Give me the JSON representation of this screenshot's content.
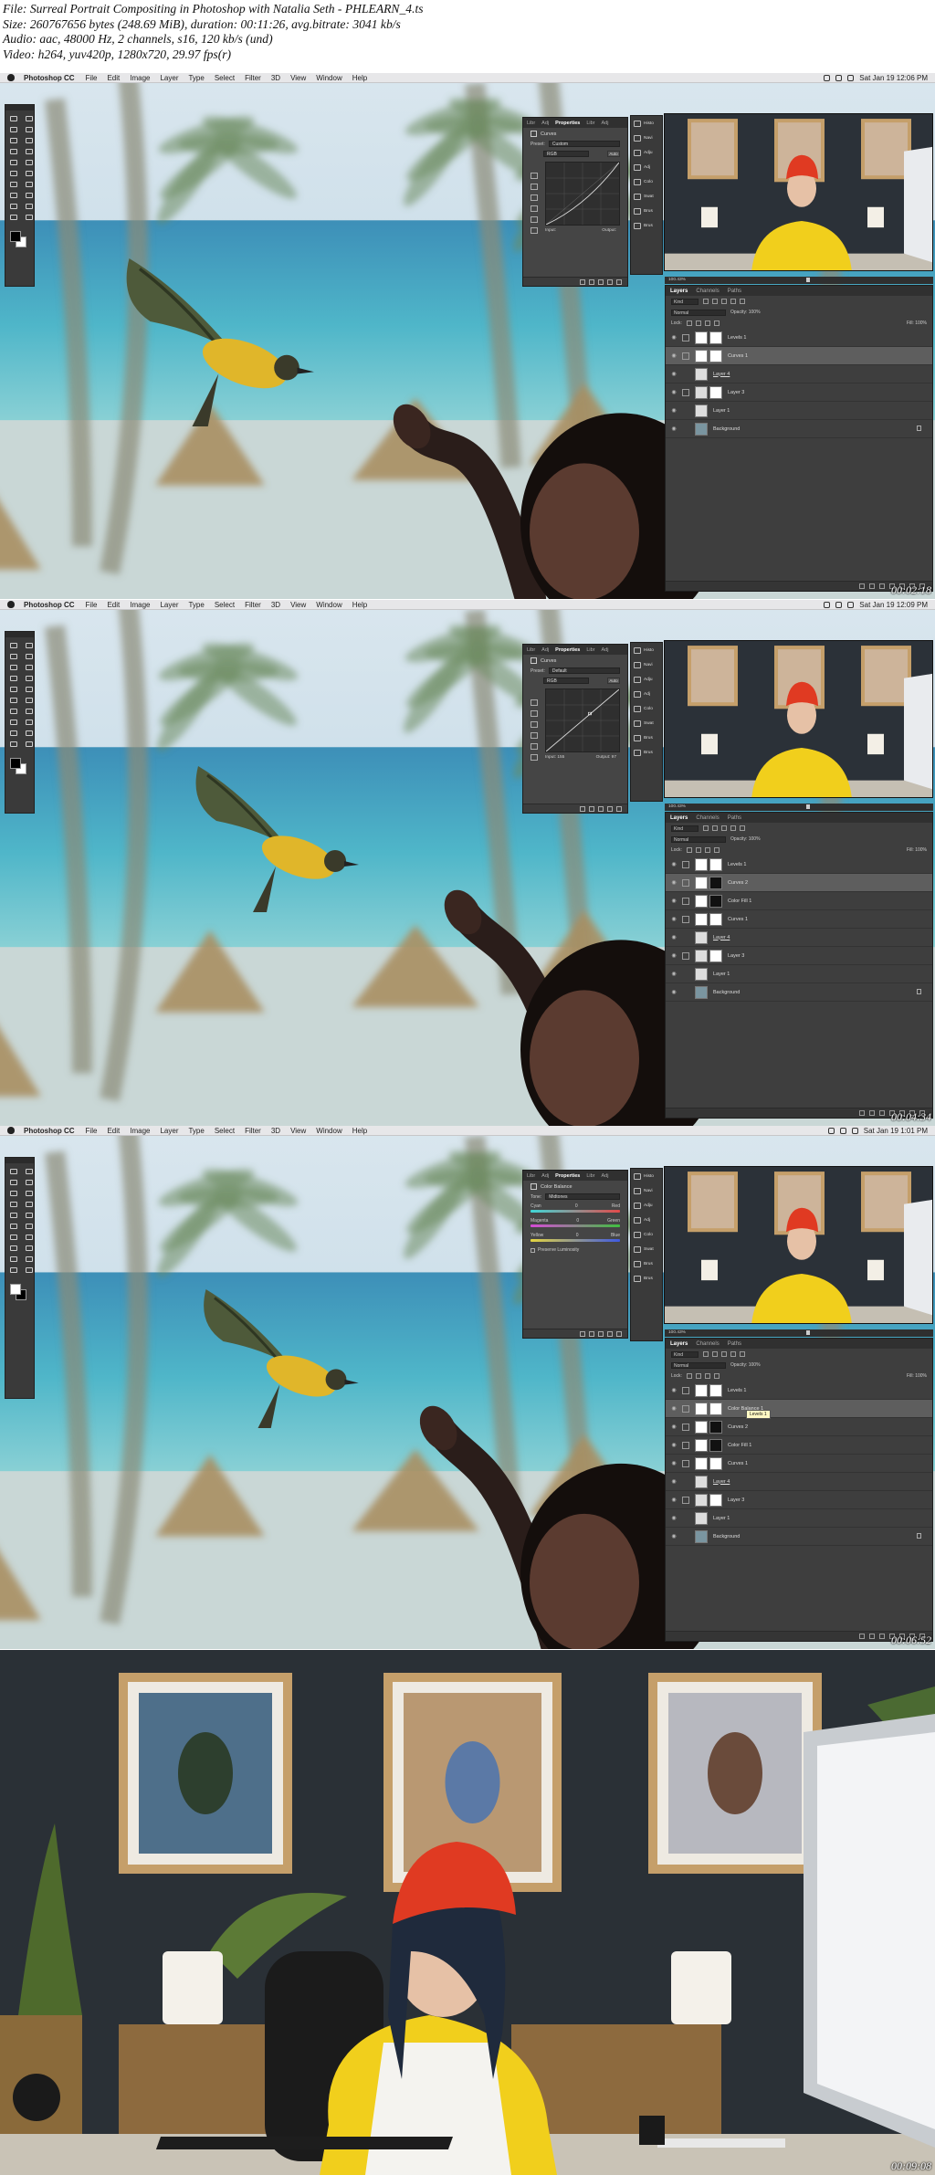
{
  "header": {
    "line1": "File: Surreal Portrait Compositing in Photoshop with Natalia Seth - PHLEARN_4.ts",
    "line2": "Size: 260767656 bytes (248.69 MiB), duration: 00:11:26, avg.bitrate: 3041 kb/s",
    "line3": "Audio: aac, 48000 Hz, 2 channels, s16, 120 kb/s (und)",
    "line4": "Video: h264, yuv420p, 1280x720, 29.97 fps(r)"
  },
  "menubar": {
    "app": "Photoshop CC",
    "items": [
      "File",
      "Edit",
      "Image",
      "Layer",
      "Type",
      "Select",
      "Filter",
      "3D",
      "View",
      "Window",
      "Help"
    ]
  },
  "colors": {
    "panel_bg": "#3e3e3e",
    "panel_header": "#303030",
    "menubar": "#e7e7e9",
    "sky": "#cfe0ea",
    "sea": "#3fa8c0",
    "bird_yellow": "#e0b62a",
    "beanie_red": "#e03a22",
    "sweater_yellow": "#f1cf1c"
  },
  "frames": [
    {
      "timestamp": "00:02:18",
      "clock": "Sat Jan 19  12:06 PM",
      "props": {
        "tabs": [
          "Libr",
          "Adj",
          "Properties",
          "Libr",
          "Adj"
        ],
        "title": "Curves",
        "preset_label": "Preset:",
        "preset_value": "Custom",
        "channel_value": "RGB",
        "auto": "Auto",
        "input": "Input:",
        "output": "Output:"
      },
      "doc": "100.43%",
      "layers_tabs": [
        "Layers",
        "Channels",
        "Paths"
      ],
      "kind_label": "Kind",
      "mode": "Normal",
      "opacity": "Opacity: 100%",
      "lock": "Lock:",
      "fill": "Fill: 100%",
      "layers": [
        {
          "name": "Levels 1",
          "thumb": "#ffffff",
          "mask": "#ffffff",
          "selected": false,
          "underline": false,
          "hasMask": true
        },
        {
          "name": "Curves 1",
          "thumb": "#ffffff",
          "mask": "#ffffff",
          "selected": true,
          "underline": false,
          "hasMask": true
        },
        {
          "name": "Layer 4",
          "thumb": "#dddddd",
          "mask": "",
          "selected": false,
          "underline": true,
          "hasMask": false
        },
        {
          "name": "Layer 3",
          "thumb": "#dddddd",
          "mask": "#ffffff",
          "selected": false,
          "underline": false,
          "hasMask": true
        },
        {
          "name": "Layer 1",
          "thumb": "#dddddd",
          "mask": "",
          "selected": false,
          "underline": false,
          "hasMask": false
        },
        {
          "name": "Background",
          "thumb": "#7a95a0",
          "mask": "",
          "selected": false,
          "underline": false,
          "hasMask": false,
          "locked": true
        }
      ]
    },
    {
      "timestamp": "00:04:34",
      "clock": "Sat Jan 19  12:09 PM",
      "props": {
        "tabs": [
          "Libr",
          "Adj",
          "Properties",
          "Libr",
          "Adj"
        ],
        "title": "Curves",
        "preset_label": "Preset:",
        "preset_value": "Default",
        "channel_value": "RGB",
        "auto": "Auto",
        "input": "Input: 155",
        "output": "Output: 97"
      },
      "doc": "100.43%",
      "layers_tabs": [
        "Layers",
        "Channels",
        "Paths"
      ],
      "kind_label": "Kind",
      "mode": "Normal",
      "opacity": "Opacity: 100%",
      "lock": "Lock:",
      "fill": "Fill: 100%",
      "layers": [
        {
          "name": "Levels 1",
          "thumb": "#ffffff",
          "mask": "#ffffff",
          "selected": false,
          "underline": false,
          "hasMask": true
        },
        {
          "name": "Curves 2",
          "thumb": "#ffffff",
          "mask": "#111111",
          "selected": true,
          "underline": false,
          "hasMask": true
        },
        {
          "name": "Color Fill 1",
          "thumb": "#ffffff",
          "mask": "#111111",
          "selected": false,
          "underline": false,
          "hasMask": true
        },
        {
          "name": "Curves 1",
          "thumb": "#ffffff",
          "mask": "#ffffff",
          "selected": false,
          "underline": false,
          "hasMask": true
        },
        {
          "name": "Layer 4",
          "thumb": "#dddddd",
          "mask": "",
          "selected": false,
          "underline": true,
          "hasMask": false
        },
        {
          "name": "Layer 3",
          "thumb": "#dddddd",
          "mask": "#ffffff",
          "selected": false,
          "underline": false,
          "hasMask": true
        },
        {
          "name": "Layer 1",
          "thumb": "#dddddd",
          "mask": "",
          "selected": false,
          "underline": false,
          "hasMask": false
        },
        {
          "name": "Background",
          "thumb": "#7a95a0",
          "mask": "",
          "selected": false,
          "underline": false,
          "hasMask": false,
          "locked": true
        }
      ]
    },
    {
      "timestamp": "00:06:52",
      "clock": "Sat Jan 19  1:01 PM",
      "props": {
        "tabs": [
          "Libr",
          "Adj",
          "Properties",
          "Libr",
          "Adj"
        ],
        "title": "Color Balance",
        "tone_label": "Tone:",
        "tone_value": "Midtones",
        "sliders": [
          {
            "left": "Cyan",
            "right": "Red",
            "value": "0"
          },
          {
            "left": "Magenta",
            "right": "Green",
            "value": "0"
          },
          {
            "left": "Yellow",
            "right": "Blue",
            "value": "0"
          }
        ],
        "preserve": "Preserve Luminosity"
      },
      "doc": "100.43%",
      "layers_tabs": [
        "Layers",
        "Channels",
        "Paths"
      ],
      "kind_label": "Kind",
      "mode": "Normal",
      "opacity": "Opacity: 100%",
      "lock": "Lock:",
      "fill": "Fill: 100%",
      "tooltip": "Levels 1",
      "layers": [
        {
          "name": "Levels 1",
          "thumb": "#ffffff",
          "mask": "#ffffff",
          "selected": false,
          "underline": false,
          "hasMask": true
        },
        {
          "name": "Color Balance 1",
          "thumb": "#ffffff",
          "mask": "#ffffff",
          "selected": true,
          "underline": false,
          "hasMask": true
        },
        {
          "name": "Curves 2",
          "thumb": "#ffffff",
          "mask": "#111111",
          "selected": false,
          "underline": false,
          "hasMask": true
        },
        {
          "name": "Color Fill 1",
          "thumb": "#ffffff",
          "mask": "#111111",
          "selected": false,
          "underline": false,
          "hasMask": true
        },
        {
          "name": "Curves 1",
          "thumb": "#ffffff",
          "mask": "#ffffff",
          "selected": false,
          "underline": false,
          "hasMask": true
        },
        {
          "name": "Layer 4",
          "thumb": "#dddddd",
          "mask": "",
          "selected": false,
          "underline": true,
          "hasMask": false
        },
        {
          "name": "Layer 3",
          "thumb": "#dddddd",
          "mask": "#ffffff",
          "selected": false,
          "underline": false,
          "hasMask": true
        },
        {
          "name": "Layer 1",
          "thumb": "#dddddd",
          "mask": "",
          "selected": false,
          "underline": false,
          "hasMask": false
        },
        {
          "name": "Background",
          "thumb": "#7a95a0",
          "mask": "",
          "selected": false,
          "underline": false,
          "hasMask": false,
          "locked": true
        }
      ]
    },
    {
      "timestamp": "00:09:08"
    }
  ],
  "icon_strip": [
    "Histo",
    "Navi",
    "Adju",
    "Adj",
    "Colo",
    "Swat",
    "Brus",
    "Brus"
  ]
}
